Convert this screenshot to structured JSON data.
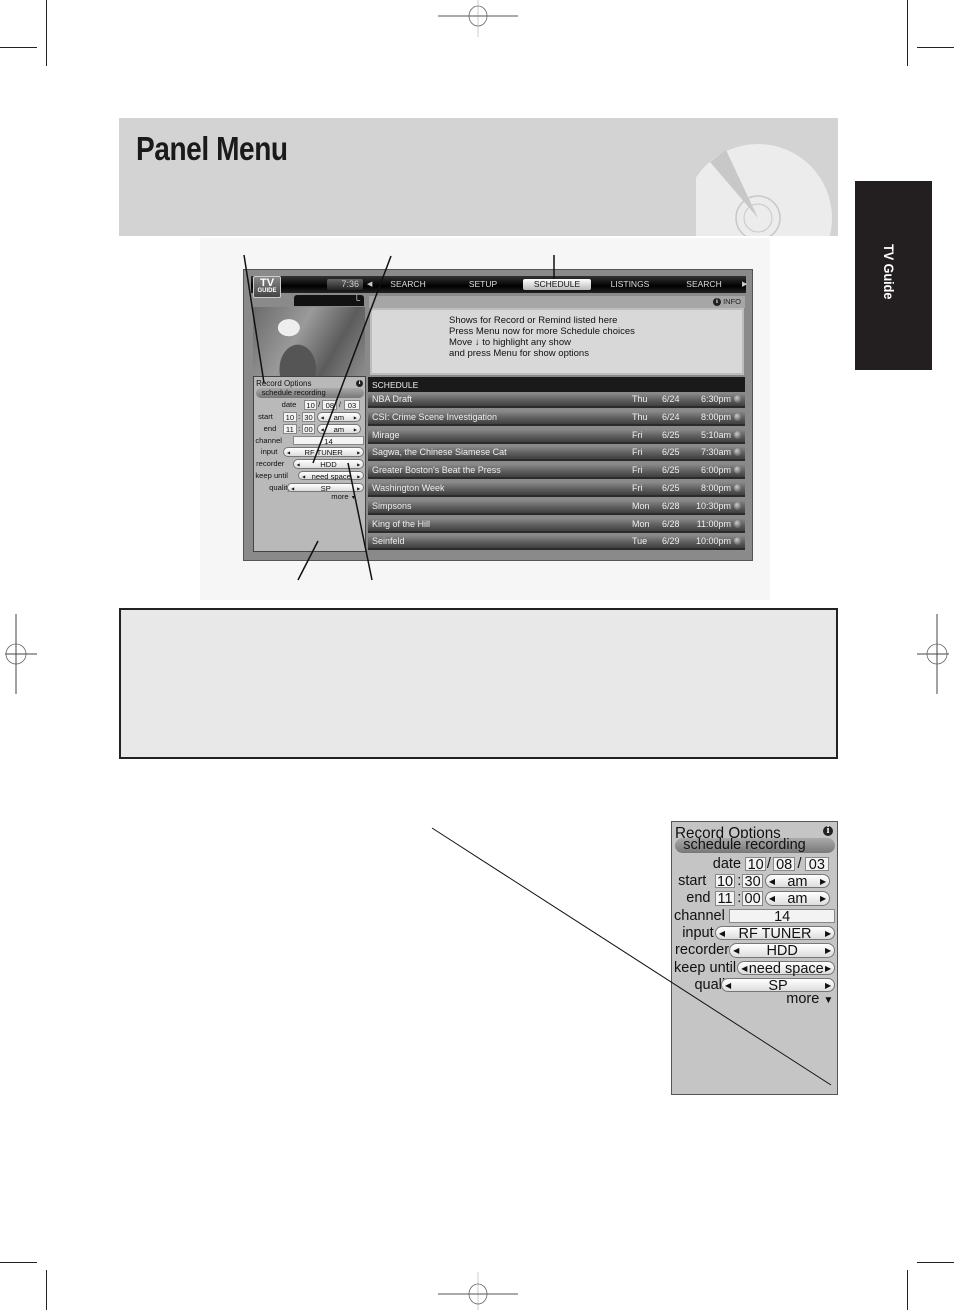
{
  "page": {
    "title": "Panel Menu",
    "side_tab": "TV Guide"
  },
  "tv_screen": {
    "logo_top": "TV",
    "logo_bottom": "GUIDE",
    "clock": "7:36",
    "nav_tabs": [
      {
        "label": "SEARCH",
        "active": false
      },
      {
        "label": "SETUP",
        "active": false
      },
      {
        "label": "SCHEDULE",
        "active": true
      },
      {
        "label": "LISTINGS",
        "active": false
      },
      {
        "label": "SEARCH",
        "active": false
      }
    ],
    "info_label": "INFO",
    "message_lines": [
      "Shows for Record or Remind listed here",
      "Press Menu now for more Schedule choices",
      "Move ↓ to highlight any show",
      "and press Menu for show options"
    ],
    "schedule_header": "SCHEDULE",
    "schedule_rows": [
      {
        "title": "NBA Draft",
        "day": "Thu",
        "date": "6/24",
        "time": "6:30pm",
        "icon": "record-icon"
      },
      {
        "title": "CSI: Crime Scene Investigation",
        "day": "Thu",
        "date": "6/24",
        "time": "8:00pm",
        "icon": "record-icon"
      },
      {
        "title": "Mirage",
        "day": "Fri",
        "date": "6/25",
        "time": "5:10am",
        "icon": "record-partial-icon"
      },
      {
        "title": "Sagwa, the Chinese Siamese Cat",
        "day": "Fri",
        "date": "6/25",
        "time": "7:30am",
        "icon": "record-repeat-icon"
      },
      {
        "title": "Greater Boston's Beat the Press",
        "day": "Fri",
        "date": "6/25",
        "time": "6:00pm",
        "icon": "remind-icon"
      },
      {
        "title": "Washington Week",
        "day": "Fri",
        "date": "6/25",
        "time": "8:00pm",
        "icon": "remind-repeat-icon"
      },
      {
        "title": "Simpsons",
        "day": "Mon",
        "date": "6/28",
        "time": "10:30pm",
        "icon": "record-repeat-icon"
      },
      {
        "title": "King of the Hill",
        "day": "Mon",
        "date": "6/28",
        "time": "11:00pm",
        "icon": "record-cancelled-icon"
      },
      {
        "title": "Seinfeld",
        "day": "Tue",
        "date": "6/29",
        "time": "10:00pm",
        "icon": "record-repeat-icon"
      }
    ]
  },
  "record_options": {
    "title": "Record Options",
    "action_button": "schedule recording",
    "date_label": "date",
    "date": [
      "10",
      "08",
      "03"
    ],
    "start_label": "start",
    "start": {
      "hour": "10",
      "minute": "30",
      "ampm": "am"
    },
    "end_label": "end",
    "end": {
      "hour": "11",
      "minute": "00",
      "ampm": "am"
    },
    "channel_label": "channel",
    "channel": "14",
    "input_label": "input",
    "input": "RF TUNER",
    "recorder_label": "recorder",
    "recorder": "HDD",
    "keep_until_label": "keep until",
    "keep_until": "need space",
    "quality_label": "quality",
    "quality": "SP",
    "more_label": "more",
    "separator_colon": ":",
    "separator_slash": "/"
  }
}
